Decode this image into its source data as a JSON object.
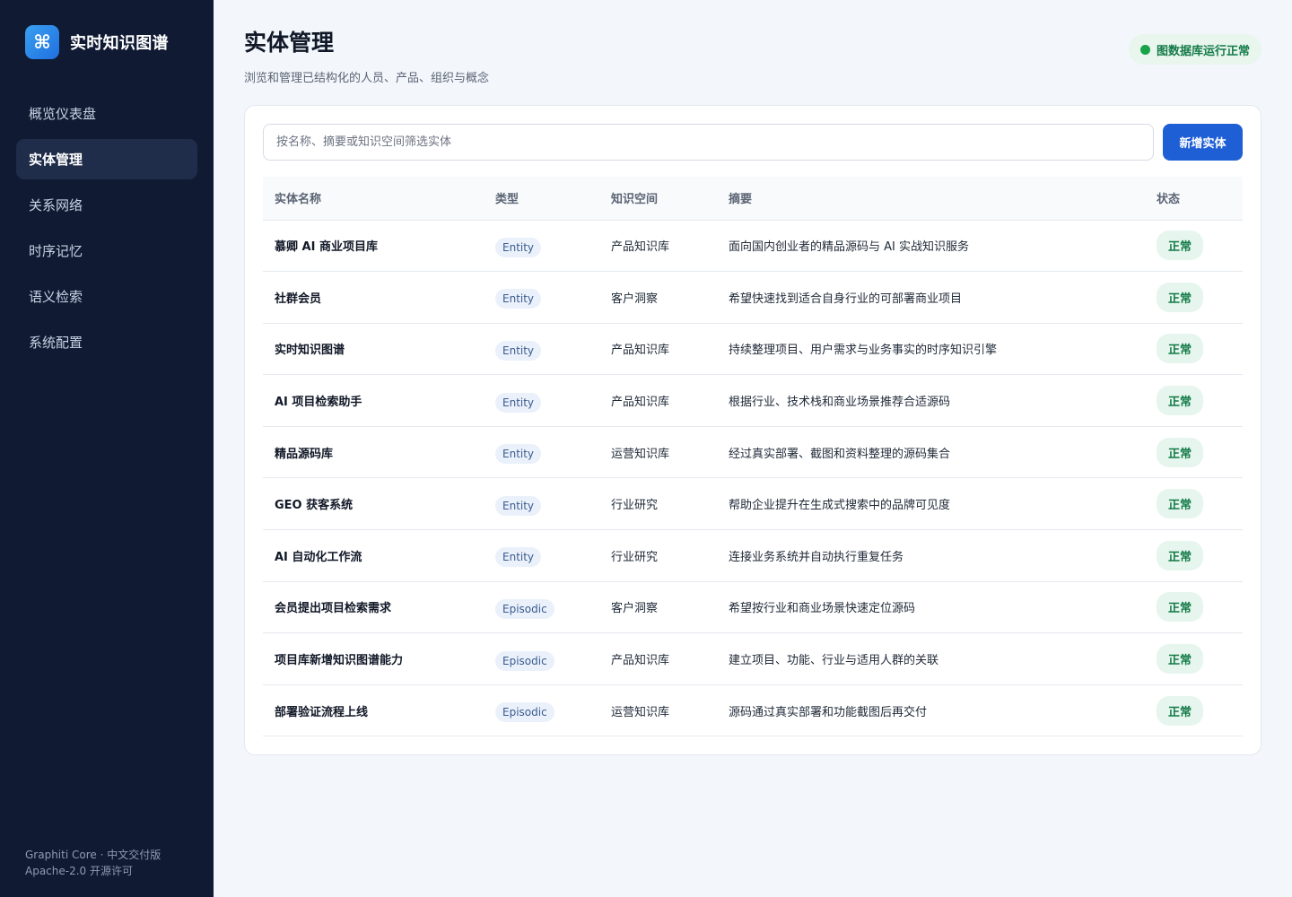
{
  "brand": {
    "logo_glyph": "⌘",
    "title": "实时知识图谱"
  },
  "nav": [
    {
      "label": "概览仪表盘",
      "active": false
    },
    {
      "label": "实体管理",
      "active": true
    },
    {
      "label": "关系网络",
      "active": false
    },
    {
      "label": "时序记忆",
      "active": false
    },
    {
      "label": "语义检索",
      "active": false
    },
    {
      "label": "系统配置",
      "active": false
    }
  ],
  "footer": {
    "line1": "Graphiti Core · 中文交付版",
    "line2": "Apache-2.0 开源许可"
  },
  "header": {
    "title": "实体管理",
    "subtitle": "浏览和管理已结构化的人员、产品、组织与概念",
    "status": "图数据库运行正常"
  },
  "search": {
    "placeholder": "按名称、摘要或知识空间筛选实体",
    "value": ""
  },
  "add_button": "新增实体",
  "table": {
    "columns": [
      "实体名称",
      "类型",
      "知识空间",
      "摘要",
      "状态"
    ],
    "rows": [
      {
        "name": "慕卿 AI 商业项目库",
        "type": "Entity",
        "space": "产品知识库",
        "summary": "面向国内创业者的精品源码与 AI 实战知识服务",
        "status": "正常"
      },
      {
        "name": "社群会员",
        "type": "Entity",
        "space": "客户洞察",
        "summary": "希望快速找到适合自身行业的可部署商业项目",
        "status": "正常"
      },
      {
        "name": "实时知识图谱",
        "type": "Entity",
        "space": "产品知识库",
        "summary": "持续整理项目、用户需求与业务事实的时序知识引擎",
        "status": "正常"
      },
      {
        "name": "AI 项目检索助手",
        "type": "Entity",
        "space": "产品知识库",
        "summary": "根据行业、技术栈和商业场景推荐合适源码",
        "status": "正常"
      },
      {
        "name": "精品源码库",
        "type": "Entity",
        "space": "运营知识库",
        "summary": "经过真实部署、截图和资料整理的源码集合",
        "status": "正常"
      },
      {
        "name": "GEO 获客系统",
        "type": "Entity",
        "space": "行业研究",
        "summary": "帮助企业提升在生成式搜索中的品牌可见度",
        "status": "正常"
      },
      {
        "name": "AI 自动化工作流",
        "type": "Entity",
        "space": "行业研究",
        "summary": "连接业务系统并自动执行重复任务",
        "status": "正常"
      },
      {
        "name": "会员提出项目检索需求",
        "type": "Episodic",
        "space": "客户洞察",
        "summary": "希望按行业和商业场景快速定位源码",
        "status": "正常"
      },
      {
        "name": "项目库新增知识图谱能力",
        "type": "Episodic",
        "space": "产品知识库",
        "summary": "建立项目、功能、行业与适用人群的关联",
        "status": "正常"
      },
      {
        "name": "部署验证流程上线",
        "type": "Episodic",
        "space": "运营知识库",
        "summary": "源码通过真实部署和功能截图后再交付",
        "status": "正常"
      }
    ]
  }
}
